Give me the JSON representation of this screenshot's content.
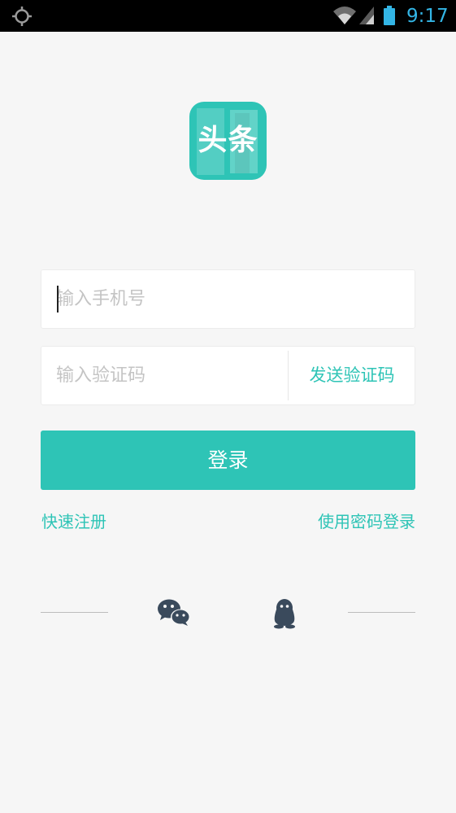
{
  "status_bar": {
    "time": "9:17",
    "icons": [
      "gps-icon",
      "wifi-icon",
      "signal-icon",
      "battery-icon"
    ],
    "accent_color": "#33b5e5"
  },
  "logo": {
    "text": "头条",
    "color": "#2ec4b6"
  },
  "phone_input": {
    "placeholder": "输入手机号",
    "value": ""
  },
  "code_input": {
    "placeholder": "输入验证码",
    "value": ""
  },
  "send_code_label": "发送验证码",
  "login_label": "登录",
  "links": {
    "register": "快速注册",
    "password_login": "使用密码登录"
  },
  "third_party": {
    "icons": [
      "wechat-icon",
      "qq-icon"
    ]
  },
  "colors": {
    "accent": "#2ec4b6",
    "background": "#f6f6f6"
  }
}
